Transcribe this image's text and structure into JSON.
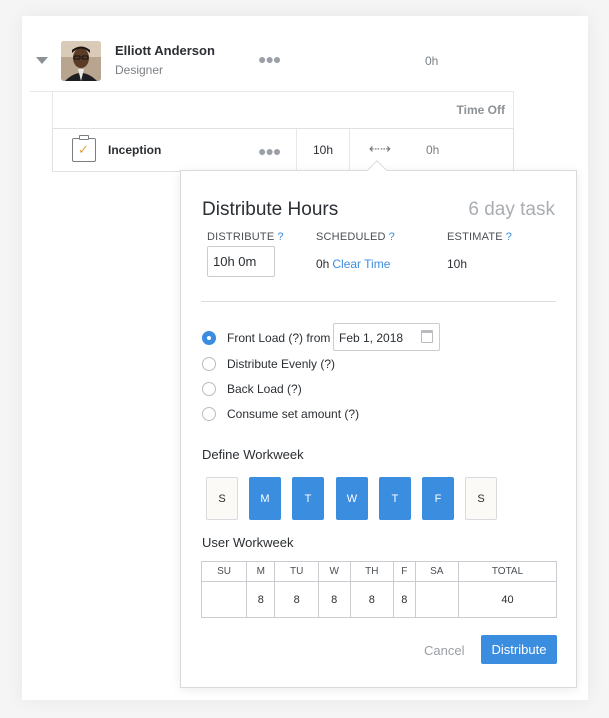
{
  "person": {
    "name": "Elliott Anderson",
    "role": "Designer",
    "hours": "0h"
  },
  "time_off": {
    "label": "Time Off"
  },
  "task": {
    "name": "Inception",
    "hours": "10h",
    "remaining": "0h"
  },
  "popover": {
    "title": "Distribute Hours",
    "subtitle": "6 day task",
    "distribute_label": "DISTRIBUTE",
    "scheduled_label": "SCHEDULED",
    "estimate_label": "ESTIMATE",
    "help_mark": "?",
    "distribute_value": "10h 0m",
    "scheduled_value": "0h",
    "clear_time": "Clear Time",
    "estimate_value": "10h",
    "options": [
      {
        "label": "Front Load (?) from",
        "selected": true
      },
      {
        "label": "Distribute Evenly (?)",
        "selected": false
      },
      {
        "label": "Back Load (?)",
        "selected": false
      },
      {
        "label": "Consume set amount (?)",
        "selected": false
      }
    ],
    "front_load_date": "Feb 1, 2018",
    "define_workweek_title": "Define Workweek",
    "workweek_days": [
      {
        "label": "S",
        "active": false
      },
      {
        "label": "M",
        "active": true
      },
      {
        "label": "T",
        "active": true
      },
      {
        "label": "W",
        "active": true
      },
      {
        "label": "T",
        "active": true
      },
      {
        "label": "F",
        "active": true
      },
      {
        "label": "S",
        "active": false
      }
    ],
    "user_workweek_title": "User Workweek",
    "table_headers": [
      "SU",
      "M",
      "TU",
      "W",
      "TH",
      "F",
      "SA",
      "TOTAL"
    ],
    "table_values": [
      "",
      "8",
      "8",
      "8",
      "8",
      "8",
      "",
      "40"
    ],
    "cancel_label": "Cancel",
    "distribute_button": "Distribute"
  },
  "colors": {
    "accent": "#3b8de0",
    "check": "#e3a33b"
  }
}
